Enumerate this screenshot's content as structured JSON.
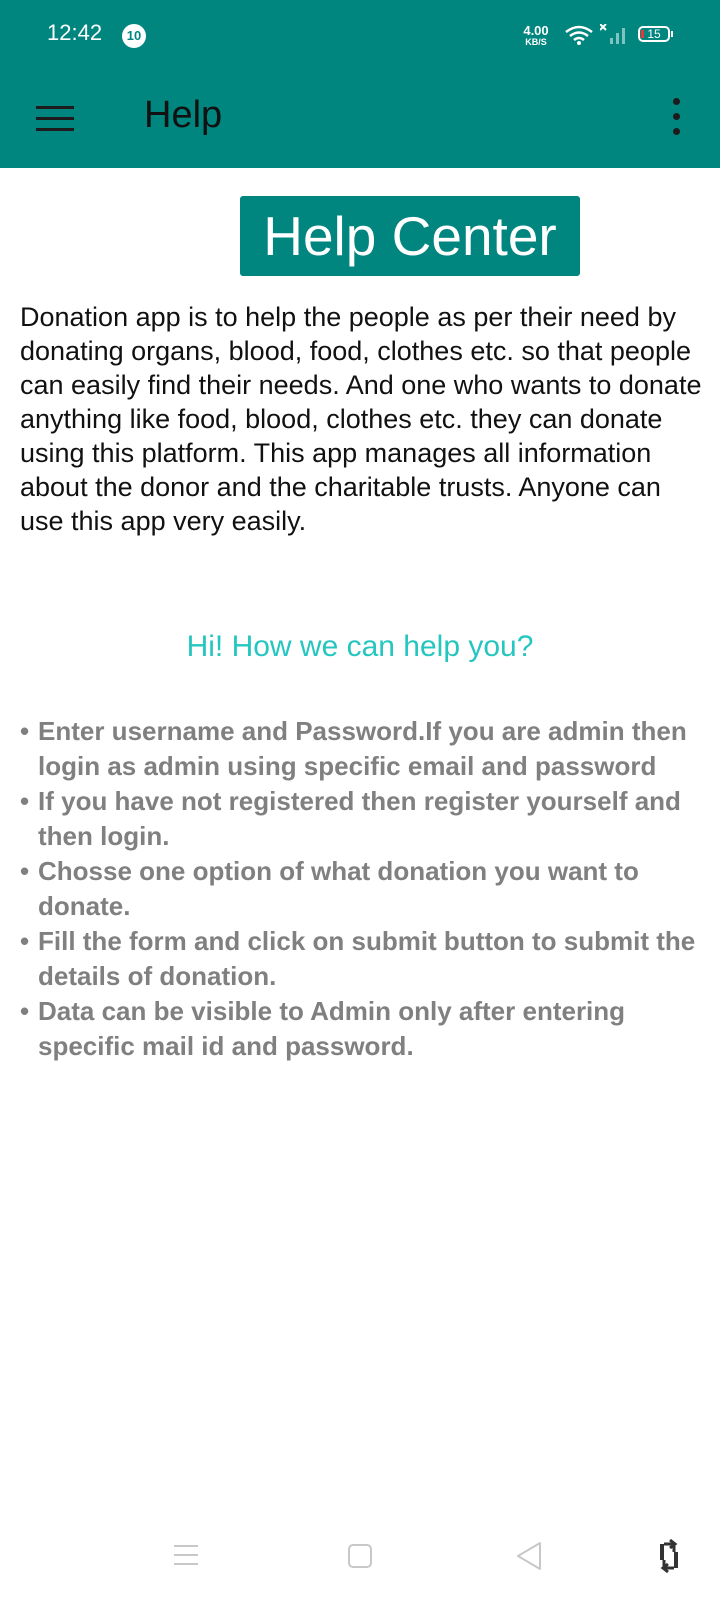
{
  "status_bar": {
    "time": "12:42",
    "notification_count": "10",
    "net_speed_value": "4.00",
    "net_speed_unit": "KB/S",
    "battery_level": "15"
  },
  "app_bar": {
    "title": "Help",
    "menu_icon": "hamburger-menu-icon",
    "overflow_icon": "more-vert-icon"
  },
  "content": {
    "heading": "Help Center",
    "intro": "Donation app is to help the people as per their need by donating organs, blood, food, clothes etc. so that people can easily find their needs. And one who wants to donate anything like food, blood, clothes etc. they can donate using this platform. This app manages all information about the donor and the charitable trusts. Anyone can use this app very easily.",
    "question": "Hi! How we can help you?",
    "bullet": "•",
    "steps": [
      "Enter username and Password.If you are admin then login as admin using specific email and password",
      "If you have not registered then register yourself and then login.",
      " Chosse one option of what donation you want to donate.",
      "Fill the form and click on submit button to submit the details of donation.",
      " Data can be visible to Admin only after entering specific mail id and password."
    ]
  },
  "colors": {
    "primary": "#00857f",
    "question_text": "#26c6c0",
    "steps_text": "#808080"
  },
  "nav_bar": {
    "icons": [
      "recents-icon",
      "home-icon",
      "back-icon",
      "rotate-icon"
    ]
  }
}
